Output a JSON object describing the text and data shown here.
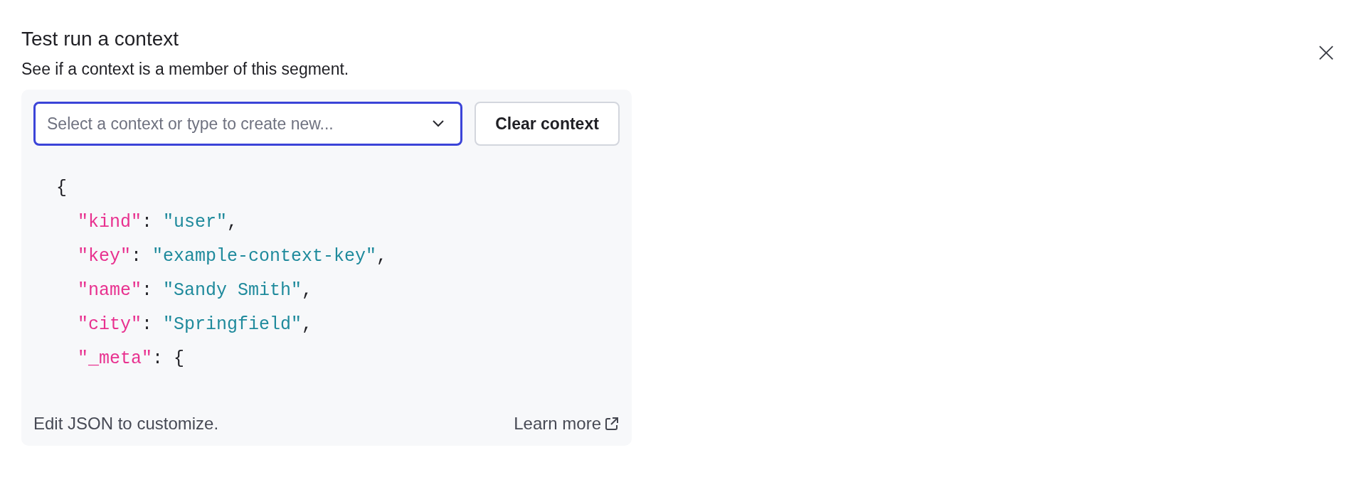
{
  "dialog": {
    "title": "Test run a context",
    "subtitle": "See if a context is a member of this segment.",
    "close": "×"
  },
  "context_select": {
    "placeholder": "Select a context or type to create new...",
    "focused": true
  },
  "clear_button": {
    "label": "Clear context"
  },
  "code": {
    "text": "{",
    "children": [
      {
        "key": "\"kind\"",
        "colon": ":",
        "value": "\"user\"",
        "kind": "string",
        "end": ","
      },
      {
        "key": "\"key\"",
        "colon": ":",
        "value": "\"example-context-key\"",
        "kind": "string",
        "end": ","
      },
      {
        "key": "\"name\"",
        "colon": ":",
        "value": "\"Sandy Smith\"",
        "kind": "string",
        "end": ","
      },
      {
        "key": "\"city\"",
        "colon": ":",
        "value": "\"Springfield\"",
        "kind": "string",
        "end": ","
      },
      {
        "key": "\"_meta\"",
        "colon": ":",
        "value": "{",
        "kind": "punct"
      }
    ]
  },
  "footer": {
    "hint": "Edit JSON to customize.",
    "link": "Learn more"
  }
}
